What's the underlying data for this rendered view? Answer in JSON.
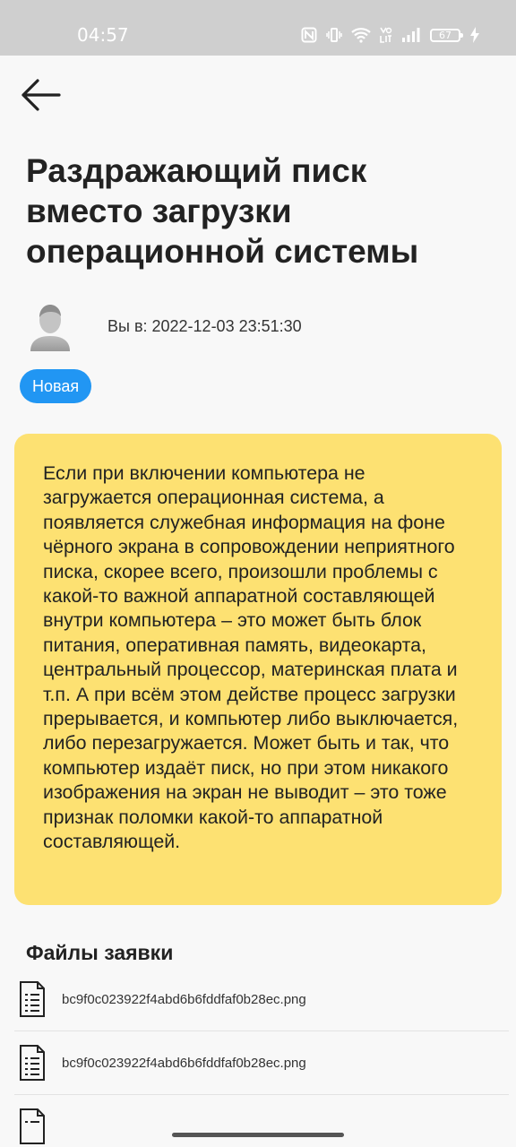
{
  "status_bar": {
    "time": "04:57",
    "battery": "67",
    "icons": [
      "nfc-icon",
      "vibrate-icon",
      "wifi-icon",
      "volte-icon",
      "signal-icon",
      "battery-icon",
      "charging-icon"
    ]
  },
  "header": {
    "back_icon": "arrow-left-icon"
  },
  "ticket": {
    "title": "Раздражающий писк вместо загрузки операционной системы",
    "date_line": "Вы в: 2022-12-03 23:51:30",
    "status": "Новая",
    "description": "Если при включении компьютера не загружается операционная система, а появляется служебная информация на фоне чёрного экрана в сопровождении неприятного писка, скорее всего, произошли проблемы с какой-то важной аппаратной составляющей внутри компьютера – это может быть блок питания, оперативная память, видеокарта, центральный процессор, материнская плата и т.п. А при всём этом действе процесс загрузки прерывается, и компьютер либо выключается, либо перезагружается. Может быть и так, что компьютер издаёт писк, но при этом никакого изображения на экран не выводит – это тоже признак поломки какой-то аппаратной составляющей."
  },
  "files": {
    "heading": "Файлы заявки",
    "items": [
      {
        "name": "bc9f0c023922f4abd6b6fddfaf0b28ec.png"
      },
      {
        "name": "bc9f0c023922f4abd6b6fddfaf0b28ec.png"
      }
    ]
  },
  "colors": {
    "status_badge": "#2196f3",
    "card_background": "#fde172",
    "status_bar": "#cfcfcf"
  }
}
